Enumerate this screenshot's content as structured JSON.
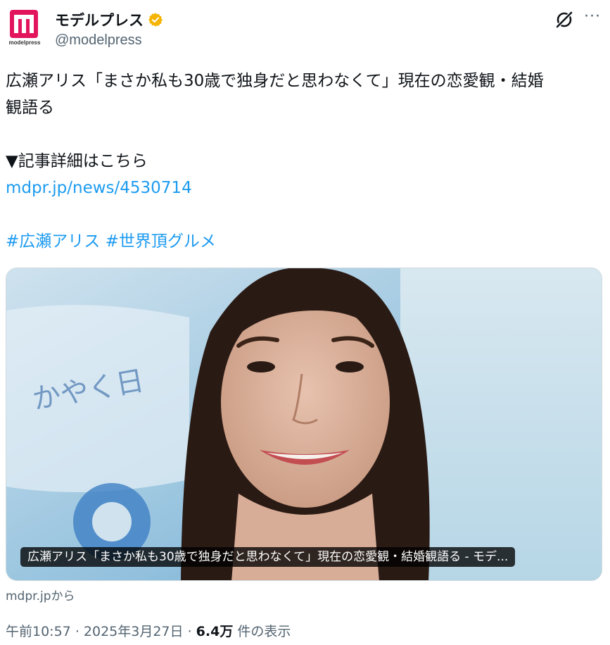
{
  "account": {
    "display_name": "モデルプレス",
    "handle": "@modelpress",
    "avatar_text": "modelpress",
    "verified_icon": "verified-badge-icon",
    "colors": {
      "brand": "#e2155c",
      "verified": "#f4b400"
    }
  },
  "actions": {
    "grok_icon": "grok-icon",
    "more_label": "···"
  },
  "tweet": {
    "lines": [
      "広瀬アリス「まさか私も30歳で独身だと思わなくて」現在の恋愛観・結婚",
      "観語る",
      "",
      "▼記事詳細はこちら"
    ],
    "link": "mdpr.jp/news/4530714",
    "hashtags": [
      "#広瀬アリス",
      "#世界頂グルメ"
    ],
    "link_color": "#1d9bf0"
  },
  "card": {
    "caption": "広瀬アリス「まさか私も30歳で独身だと思わなくて」現在の恋愛観・結婚観語る - モデ...",
    "source": "mdpr.jpから"
  },
  "meta": {
    "time": "午前10:57",
    "separator": "·",
    "date": "2025年3月27日",
    "views": "6.4万",
    "views_suffix": "件の表示"
  }
}
